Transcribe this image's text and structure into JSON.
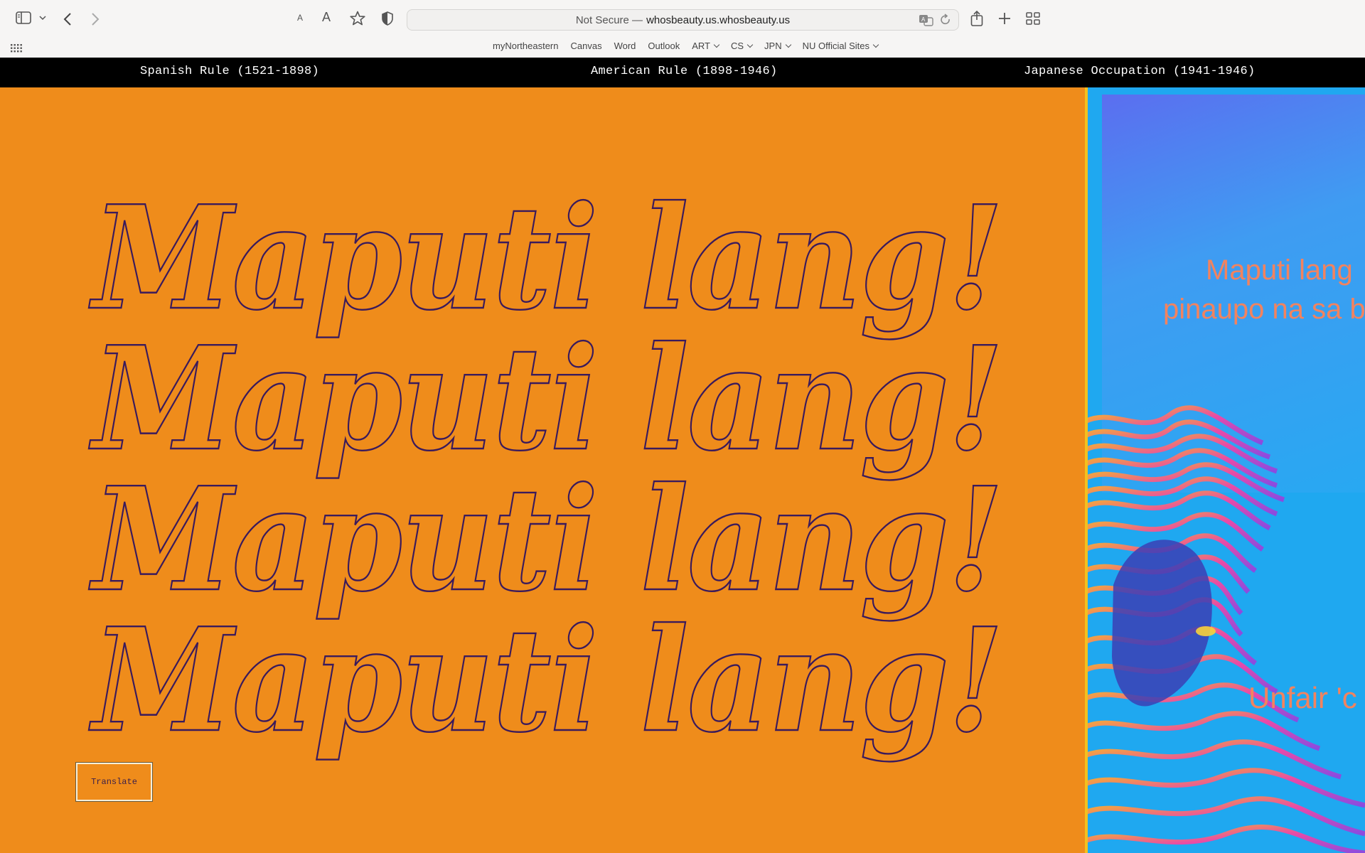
{
  "browser": {
    "address": {
      "security_label": "Not Secure —",
      "domain": "whosbeauty.us.whosbeauty.us"
    },
    "bookmarks": [
      {
        "label": "myNortheastern",
        "has_menu": false
      },
      {
        "label": "Canvas",
        "has_menu": false
      },
      {
        "label": "Word",
        "has_menu": false
      },
      {
        "label": "Outlook",
        "has_menu": false
      },
      {
        "label": "ART",
        "has_menu": true
      },
      {
        "label": "CS",
        "has_menu": true
      },
      {
        "label": "JPN",
        "has_menu": true
      },
      {
        "label": "NU Official Sites",
        "has_menu": true
      }
    ],
    "icons": {
      "sidebar": "sidebar-icon",
      "back": "chevron-left-icon",
      "forward": "chevron-right-icon",
      "text_smaller": "text-smaller-icon",
      "text_larger": "text-larger-icon",
      "bookmark": "star-icon",
      "privacy": "shield-icon",
      "translate": "translate-icon",
      "reload": "reload-icon",
      "share": "share-icon",
      "new_tab": "plus-icon",
      "tab_overview": "grid-icon",
      "apps": "apps-grid-icon"
    }
  },
  "site_nav": {
    "links": [
      "Spanish Rule (1521-1898)",
      "American Rule (1898-1946)",
      "Japanese Occupation (1941-1946)"
    ]
  },
  "hero": {
    "headline_lines": [
      "Maputi lang!",
      "Maputi lang!",
      "Maputi lang!",
      "Maputi lang!"
    ],
    "translate_label": "Translate"
  },
  "poster": {
    "text_line_1": "Maputi lang",
    "text_line_2": "pinaupo na sa b",
    "text_line_3": "Unfair 'c"
  },
  "colors": {
    "hero_bg": "#ef8c1b",
    "headline_stroke": "#3a1a5c",
    "nav_bg": "#000000",
    "poster_bg": "#1fa8f0"
  }
}
